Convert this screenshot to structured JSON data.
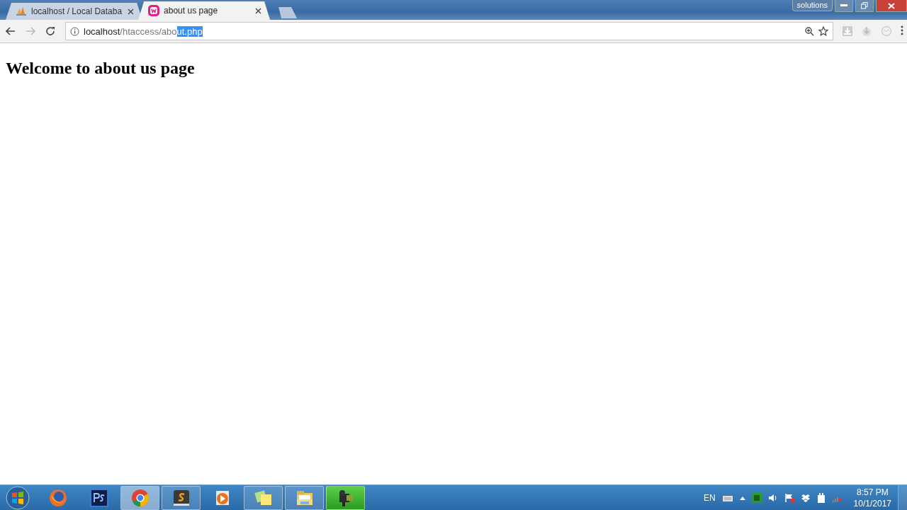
{
  "window": {
    "profile_button": "solutions"
  },
  "tabs": [
    {
      "title": "localhost / Local Databa",
      "selected": false
    },
    {
      "title": "about us page",
      "selected": true
    }
  ],
  "address_bar": {
    "host": "localhost",
    "path": "/htaccess/abo",
    "selected_text": "ut.php"
  },
  "page": {
    "heading": "Welcome to about us page"
  },
  "taskbar": {
    "apps": [
      {
        "kind": "firefox",
        "running": false,
        "selected": false,
        "flashing": false
      },
      {
        "kind": "photoshop",
        "running": false,
        "selected": false,
        "flashing": false
      },
      {
        "kind": "chrome",
        "running": true,
        "selected": true,
        "flashing": false
      },
      {
        "kind": "sublime",
        "running": true,
        "selected": false,
        "flashing": false
      },
      {
        "kind": "media",
        "running": false,
        "selected": false,
        "flashing": false
      },
      {
        "kind": "notes",
        "running": true,
        "selected": false,
        "flashing": false
      },
      {
        "kind": "explorer",
        "running": true,
        "selected": false,
        "flashing": false
      },
      {
        "kind": "camcorder",
        "running": true,
        "selected": false,
        "flashing": true
      }
    ],
    "tray": {
      "language": "EN",
      "time": "8:57 PM",
      "date": "10/1/2017"
    }
  }
}
